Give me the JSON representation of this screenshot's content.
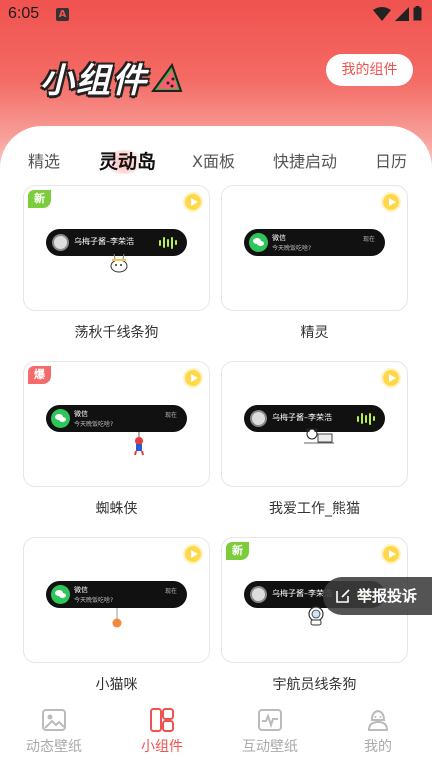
{
  "status_bar": {
    "time": "6:05",
    "app_icon": "A"
  },
  "header": {
    "title": "小组件",
    "my_widgets_button": "我的组件"
  },
  "tabs": [
    {
      "label": "精选",
      "active": false
    },
    {
      "label": "灵动岛",
      "active": true
    },
    {
      "label": "X面板",
      "active": false
    },
    {
      "label": "快捷启动",
      "active": false
    },
    {
      "label": "日历",
      "active": false
    }
  ],
  "cards": [
    {
      "label": "荡秋千线条狗",
      "badge": "新",
      "island": {
        "type": "music",
        "text": "乌梅子酱–李荣浩"
      }
    },
    {
      "label": "精灵",
      "badge": "",
      "island": {
        "type": "wechat",
        "name": "微信",
        "message": "今天晚饭吃啥?",
        "time": "现在"
      }
    },
    {
      "label": "蜘蛛侠",
      "badge": "爆",
      "island": {
        "type": "wechat",
        "name": "微信",
        "message": "今天晚饭吃啥?",
        "time": "现在"
      }
    },
    {
      "label": "我爱工作_熊猫",
      "badge": "",
      "island": {
        "type": "music",
        "text": "乌梅子酱–李荣浩"
      }
    },
    {
      "label": "小猫咪",
      "badge": "",
      "island": {
        "type": "wechat",
        "name": "微信",
        "message": "今天晚饭吃啥?",
        "time": "现在"
      }
    },
    {
      "label": "宇航员线条狗",
      "badge": "新",
      "island": {
        "type": "music",
        "text": "乌梅子酱–李荣浩"
      }
    }
  ],
  "report_button": "举报投诉",
  "bottom_nav": [
    {
      "label": "动态壁纸",
      "active": false,
      "icon": "image-icon"
    },
    {
      "label": "小组件",
      "active": true,
      "icon": "widget-grid-icon"
    },
    {
      "label": "互动壁纸",
      "active": false,
      "icon": "pulse-icon"
    },
    {
      "label": "我的",
      "active": false,
      "icon": "profile-icon"
    }
  ],
  "colors": {
    "accent": "#f0524f",
    "badge_new": "#7ccc3b",
    "badge_hot": "#f56a6a",
    "play": "#ffd84a"
  }
}
